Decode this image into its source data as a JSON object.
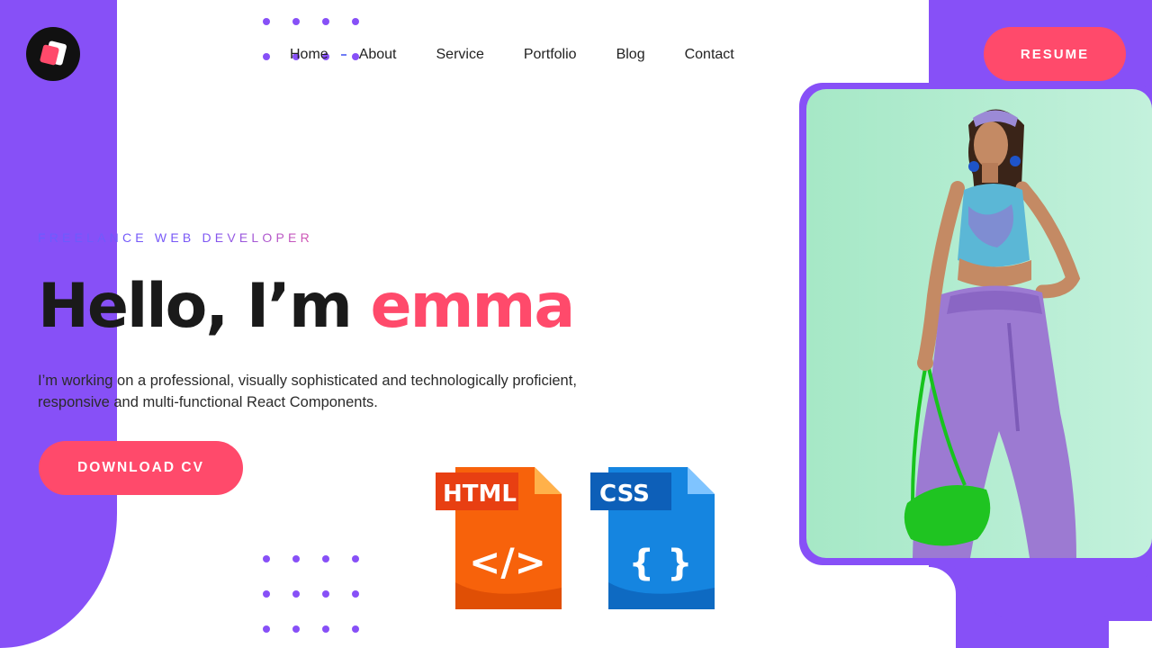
{
  "nav": {
    "items": [
      {
        "label": "Home"
      },
      {
        "label": "About"
      },
      {
        "label": "Service"
      },
      {
        "label": "Portfolio"
      },
      {
        "label": "Blog"
      },
      {
        "label": "Contact"
      }
    ],
    "resume_label": "RESUME"
  },
  "hero": {
    "tagline": "FREELANCE WEB DEVELOPER",
    "greeting": "Hello, I’m ",
    "name": "emma",
    "description": "I’m working on a professional, visually sophisticated and technologically proficient, responsive and multi-functional React Components.",
    "download_label": "DOWNLOAD CV"
  },
  "file_icons": {
    "html": {
      "label": "HTML",
      "icon": "html-file-icon",
      "glyph": "</>"
    },
    "css": {
      "label": "CSS",
      "icon": "css-file-icon",
      "glyph": "{ }"
    }
  },
  "colors": {
    "accent": "#ff4a6b",
    "purple": "#8750f7",
    "html_orange": "#f7620b",
    "css_blue": "#0f73d4"
  },
  "icons": {
    "logo": "brand-logo-icon",
    "photo": "profile-photo"
  }
}
